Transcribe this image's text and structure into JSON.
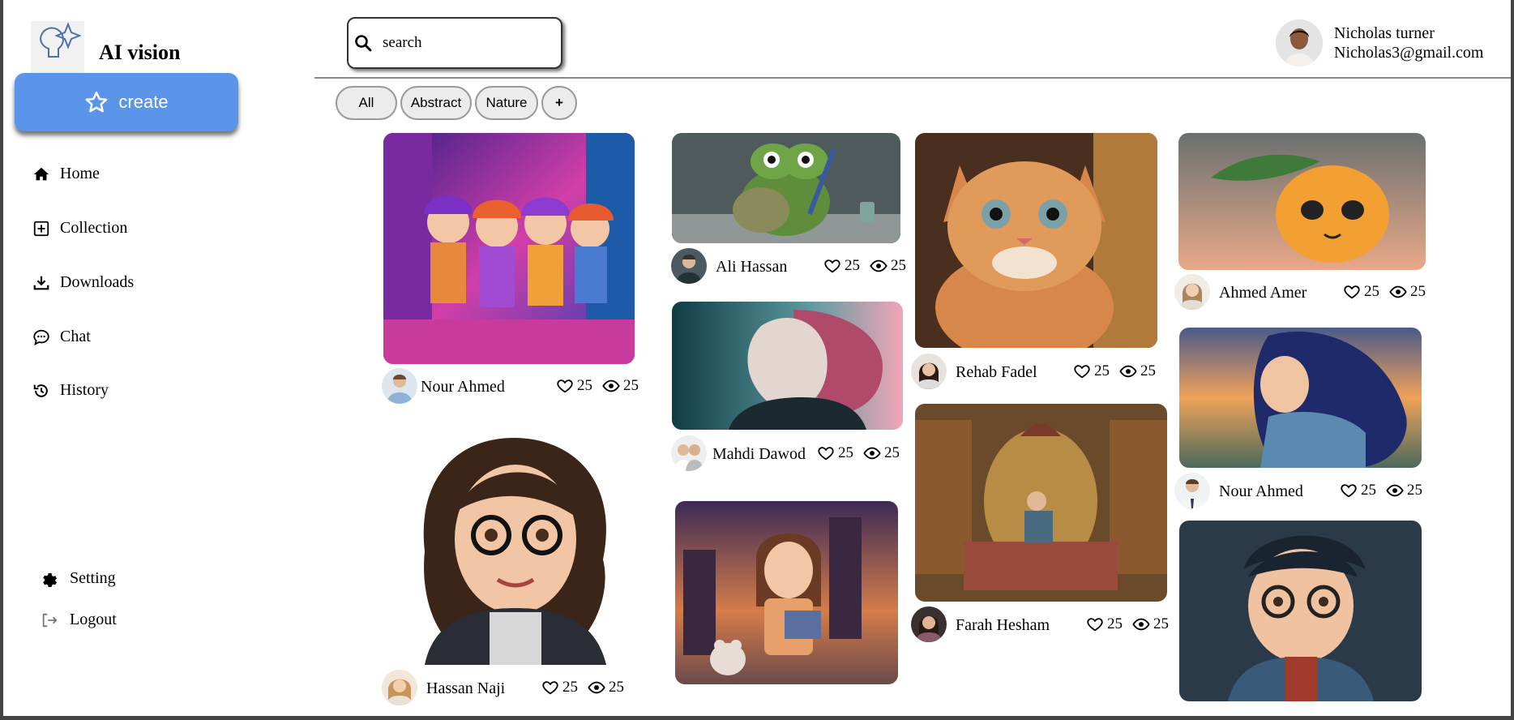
{
  "app": {
    "title": "AI vision",
    "create_label": "create"
  },
  "nav": [
    {
      "label": "Home",
      "icon": "home-icon"
    },
    {
      "label": "Collection",
      "icon": "collection-icon"
    },
    {
      "label": "Downloads",
      "icon": "download-icon"
    },
    {
      "label": "Chat",
      "icon": "chat-icon"
    },
    {
      "label": "History",
      "icon": "history-icon"
    }
  ],
  "bottom_nav": [
    {
      "label": "Setting",
      "icon": "gear-icon"
    },
    {
      "label": "Logout",
      "icon": "logout-icon"
    }
  ],
  "search": {
    "placeholder": "search",
    "value": ""
  },
  "user": {
    "name": "Nicholas turner",
    "email": "Nicholas3@gmail.com"
  },
  "filters": [
    "All",
    "Abstract",
    "Nature",
    "+"
  ],
  "cards": [
    {
      "author": "Nour Ahmed",
      "likes": "25",
      "views": "25",
      "image": "girls-walking-city-street"
    },
    {
      "author": "Hassan Naji",
      "likes": "25",
      "views": "25",
      "image": "cartoon-girl-with-glasses"
    },
    {
      "author": "Ali Hassan",
      "likes": "25",
      "views": "25",
      "image": "turtle-painter"
    },
    {
      "author": "Mahdi Dawod",
      "likes": "25",
      "views": "25",
      "image": "cyber-woman-profile"
    },
    {
      "author": "",
      "likes": "",
      "views": "",
      "image": "girl-with-book-and-teddy"
    },
    {
      "author": "Rehab Fadel",
      "likes": "25",
      "views": "25",
      "image": "orange-kitten"
    },
    {
      "author": "Farah Hesham",
      "likes": "25",
      "views": "25",
      "image": "man-reading-in-library"
    },
    {
      "author": "Ahmed Amer",
      "likes": "25",
      "views": "25",
      "image": "cute-mango-fruit"
    },
    {
      "author": "Nour Ahmed",
      "likes": "25",
      "views": "25",
      "image": "girl-at-sunset"
    },
    {
      "author": "",
      "likes": "",
      "views": "",
      "image": "cartoon-boy-with-glasses"
    }
  ],
  "colors": {
    "accent": "#5b95ea",
    "divider": "#888888",
    "chip_bg": "#ececec"
  }
}
